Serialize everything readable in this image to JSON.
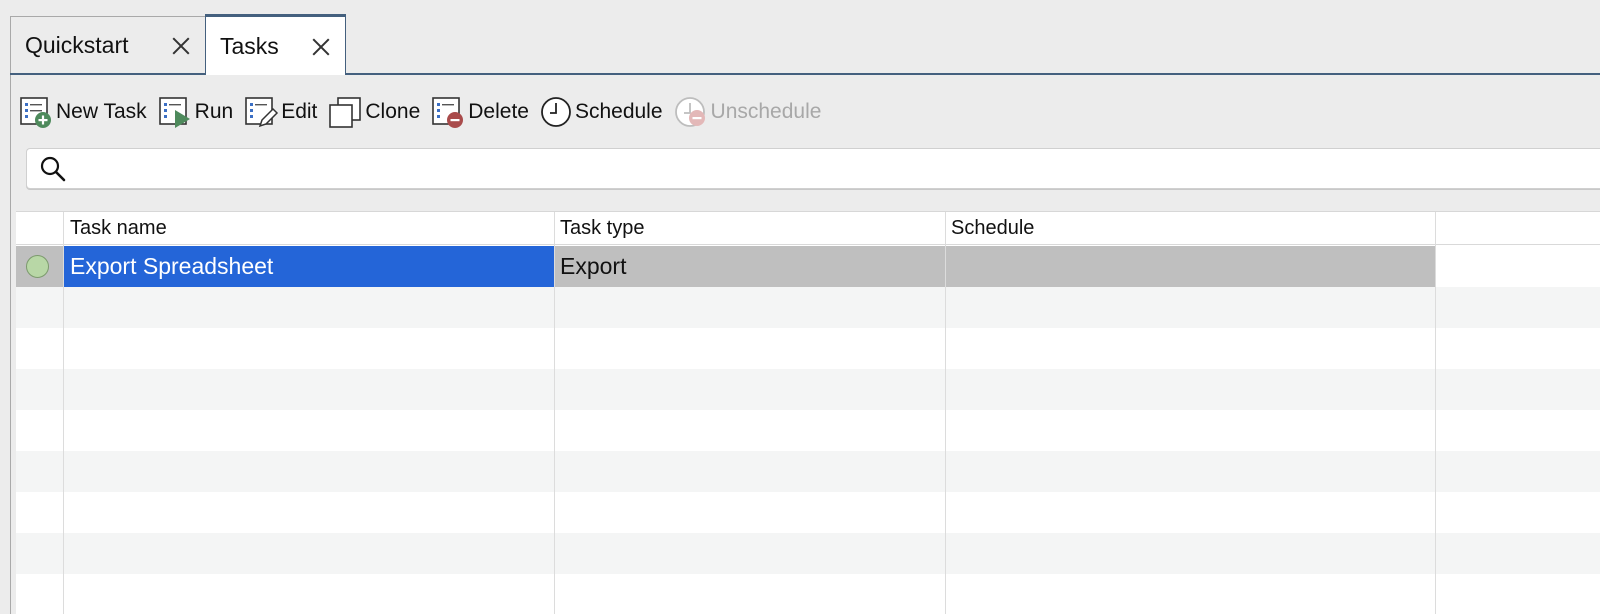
{
  "tabs": [
    {
      "label": "Quickstart",
      "active": false
    },
    {
      "label": "Tasks",
      "active": true
    }
  ],
  "toolbar": {
    "new_task": "New Task",
    "run": "Run",
    "edit": "Edit",
    "clone": "Clone",
    "delete": "Delete",
    "schedule": "Schedule",
    "unschedule": "Unschedule"
  },
  "search": {
    "value": "",
    "placeholder": ""
  },
  "table": {
    "columns": [
      "Task name",
      "Task type",
      "Schedule"
    ],
    "rows": [
      {
        "status": "idle",
        "task_name": "Export Spreadsheet",
        "task_type": "Export",
        "schedule": "",
        "selected": true
      }
    ]
  },
  "colors": {
    "selection": "#2465d8",
    "active_tab_border": "#44607e",
    "status_dot": "#b8d7a6",
    "add_badge": "#4e8a5c",
    "delete_badge": "#a94b4b",
    "run_arrow": "#4e8a5c"
  },
  "icons": {
    "new_task": "task-add-icon",
    "run": "task-run-icon",
    "edit": "task-edit-icon",
    "clone": "clone-icon",
    "delete": "task-delete-icon",
    "schedule": "clock-icon",
    "unschedule": "clock-remove-icon",
    "search": "search-icon",
    "close": "close-icon"
  }
}
